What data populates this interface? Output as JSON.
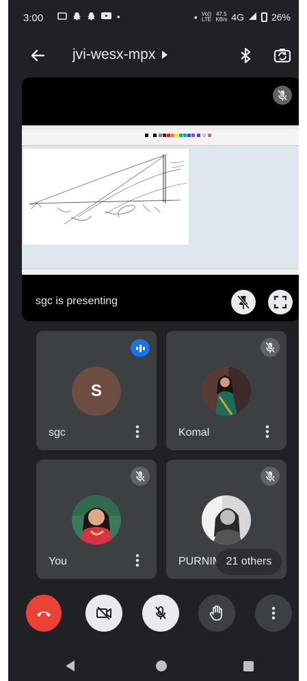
{
  "status_bar": {
    "time": "3:00",
    "volte_top": "Vo))",
    "volte_bottom": "LTE",
    "speed_top": "47.5",
    "speed_bottom": "KB/s",
    "network": "4G",
    "battery": "26%",
    "dot": "•"
  },
  "header": {
    "meeting_code": "jvi-wesx-mpx"
  },
  "presentation": {
    "presenter_label": "sgc is presenting"
  },
  "tiles": [
    {
      "name": "sgc",
      "avatar_letter": "S",
      "state": "speaking"
    },
    {
      "name": "Komal",
      "state": "muted"
    },
    {
      "name": "You",
      "state": "muted"
    },
    {
      "name": "PURNIMA",
      "state": "muted"
    }
  ],
  "others": {
    "label": "21 others"
  },
  "icons": {
    "back": "arrow-left-icon",
    "bluetooth": "bluetooth-icon",
    "switch_camera": "switch-camera-icon",
    "mic_off": "mic-off-icon",
    "unpin": "unpin-icon",
    "fullscreen": "fullscreen-icon",
    "end_call": "end-call-icon",
    "video_off": "video-off-icon",
    "raise_hand": "raise-hand-icon",
    "more": "more-vertical-icon"
  },
  "colors": {
    "background": "#202124",
    "tile": "#3c4043",
    "accent_blue": "#1a73e8",
    "end_call_red": "#ea4335",
    "avatar_s": "#6d4c41"
  }
}
